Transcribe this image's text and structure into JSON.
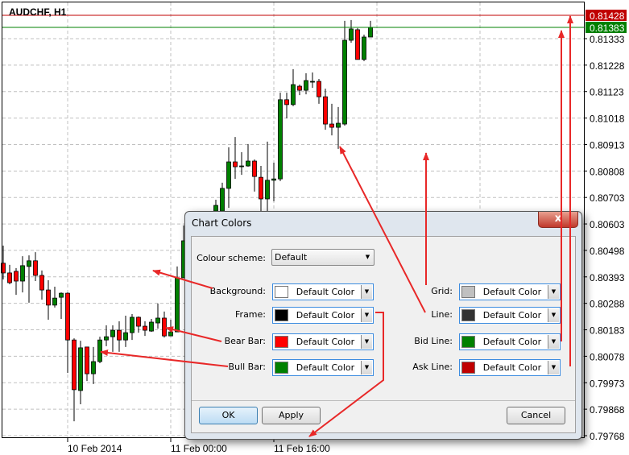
{
  "chart": {
    "symbol_title": "AUDCHF, H1",
    "y_ticks": [
      "0.81333",
      "0.81228",
      "0.81123",
      "0.81018",
      "0.80913",
      "0.80808",
      "0.80703",
      "0.80603",
      "0.80498",
      "0.80393",
      "0.80288",
      "0.80183",
      "0.80078",
      "0.79973",
      "0.79868",
      "0.79768"
    ],
    "x_ticks": [
      "10 Feb 2014",
      "11 Feb 00:00",
      "11 Feb 16:00"
    ],
    "ask_price": "0.81428",
    "bid_price": "0.81383",
    "colors": {
      "bull": "#008000",
      "bear": "#ff0000",
      "grid": "#c0c0c0",
      "frame": "#000000",
      "bid": "#008000",
      "ask": "#c00000",
      "background": "#ffffff"
    },
    "candles_ohlc": [
      [
        0.80502,
        0.80567,
        0.80442,
        0.80466
      ],
      [
        0.80466,
        0.80496,
        0.80424,
        0.8043
      ],
      [
        0.80472,
        0.80484,
        0.80385,
        0.80436
      ],
      [
        0.80436,
        0.80528,
        0.80394,
        0.80493
      ],
      [
        0.8049,
        0.80531,
        0.80356,
        0.80511
      ],
      [
        0.80511,
        0.80543,
        0.80436,
        0.80457
      ],
      [
        0.80457,
        0.80475,
        0.80367,
        0.80403
      ],
      [
        0.80403,
        0.80439,
        0.80293,
        0.80347
      ],
      [
        0.80347,
        0.80415,
        0.80338,
        0.80373
      ],
      [
        0.80376,
        0.80394,
        0.80296,
        0.80391
      ],
      [
        0.80391,
        0.80394,
        0.80096,
        0.80218
      ],
      [
        0.80218,
        0.80224,
        0.79917,
        0.80034
      ],
      [
        0.80031,
        0.80215,
        0.7998,
        0.80189
      ],
      [
        0.80192,
        0.80192,
        0.80066,
        0.80093
      ],
      [
        0.80093,
        0.80192,
        0.80055,
        0.80138
      ],
      [
        0.80138,
        0.8023,
        0.80132,
        0.80218
      ],
      [
        0.80218,
        0.80272,
        0.80195,
        0.8023
      ],
      [
        0.8023,
        0.80272,
        0.80174,
        0.80254
      ],
      [
        0.80254,
        0.80287,
        0.80174,
        0.80218
      ],
      [
        0.80218,
        0.80308,
        0.80192,
        0.80245
      ],
      [
        0.80245,
        0.80314,
        0.80218,
        0.80302
      ],
      [
        0.80302,
        0.80305,
        0.80245,
        0.80269
      ],
      [
        0.80269,
        0.80287,
        0.80233,
        0.80254
      ],
      [
        0.80251,
        0.80296,
        0.80248,
        0.80284
      ],
      [
        0.80281,
        0.80353,
        0.8026,
        0.80299
      ],
      [
        0.80299,
        0.80323,
        0.80227,
        0.80233
      ],
      [
        0.80233,
        0.80293,
        0.80233,
        0.80248
      ],
      [
        0.80248,
        0.8049,
        0.80248,
        0.80448
      ],
      [
        0.80448,
        0.80642,
        0.80448,
        0.80585
      ],
      null,
      null,
      null,
      null,
      [
        0.80695,
        0.80737,
        0.80695,
        0.80716
      ],
      [
        0.80695,
        0.808,
        0.80695,
        0.80779
      ],
      [
        0.80779,
        0.80931,
        0.80707,
        0.80877
      ],
      [
        0.80877,
        0.80969,
        0.80814,
        0.80859
      ],
      [
        0.80862,
        0.80913,
        0.80829,
        0.80862
      ],
      [
        0.80862,
        0.80943,
        0.80859,
        0.8088
      ],
      [
        0.8088,
        0.80886,
        0.80767,
        0.80823
      ],
      [
        0.8082,
        0.80862,
        0.80695,
        0.8074
      ],
      [
        0.8074,
        0.80952,
        0.80695,
        0.80809
      ],
      [
        0.80809,
        0.80874,
        0.80731,
        0.80814
      ],
      [
        0.80814,
        0.81133,
        0.80806,
        0.81107
      ],
      [
        0.81107,
        0.81133,
        0.81038,
        0.81089
      ],
      [
        0.81089,
        0.8122,
        0.81083,
        0.81163
      ],
      [
        0.81157,
        0.81163,
        0.81124,
        0.81142
      ],
      [
        0.81142,
        0.81205,
        0.81127,
        0.81178
      ],
      [
        0.81175,
        0.81208,
        0.81151,
        0.81175
      ],
      [
        0.81175,
        0.81184,
        0.81092,
        0.81118
      ],
      [
        0.81118,
        0.81148,
        0.80996,
        0.81017
      ],
      [
        0.81017,
        0.81092,
        0.80975,
        0.81005
      ],
      [
        0.81005,
        0.8108,
        0.80925,
        0.8102
      ],
      [
        0.81017,
        0.81399,
        0.81011,
        0.81327
      ],
      [
        0.81327,
        0.81402,
        0.81318,
        0.81369
      ],
      [
        0.81366,
        0.81372,
        0.81256,
        0.81256
      ],
      [
        0.81256,
        0.81348,
        0.8125,
        0.81339
      ],
      [
        0.81339,
        0.81399,
        0.81339,
        0.81375
      ]
    ]
  },
  "dialog": {
    "title": "Chart Colors",
    "close_icon": "close-x-icon",
    "close_label": "x",
    "colour_scheme_label": "Colour scheme:",
    "colour_scheme_value": "Default",
    "left_rows": [
      {
        "label": "Background:",
        "value": "Default Color",
        "swatch": "#ffffff"
      },
      {
        "label": "Frame:",
        "value": "Default Color",
        "swatch": "#000000"
      },
      {
        "label": "Bear Bar:",
        "value": "Default Color",
        "swatch": "#ff0000"
      },
      {
        "label": "Bull Bar:",
        "value": "Default Color",
        "swatch": "#008000"
      }
    ],
    "right_rows": [
      {
        "label": "Grid:",
        "value": "Default Color",
        "swatch": "#c0c0c0"
      },
      {
        "label": "Line:",
        "value": "Default Color",
        "swatch": "#333333"
      },
      {
        "label": "Bid Line:",
        "value": "Default Color",
        "swatch": "#008000"
      },
      {
        "label": "Ask Line:",
        "value": "Default Color",
        "swatch": "#c00000"
      }
    ],
    "ok_label": "OK",
    "apply_label": "Apply",
    "cancel_label": "Cancel"
  },
  "annotation_color": "#e82828"
}
